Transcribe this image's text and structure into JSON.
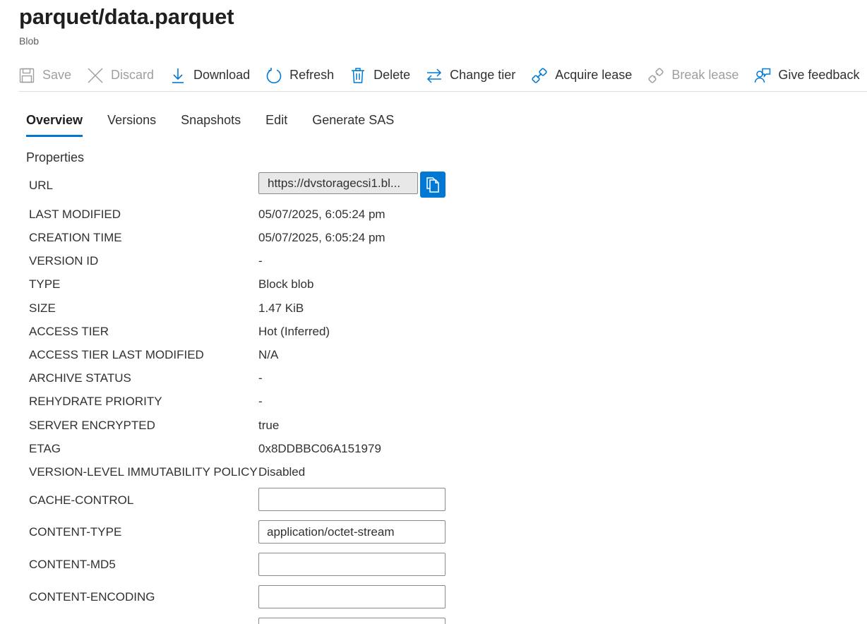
{
  "header": {
    "title": "parquet/data.parquet",
    "subtitle": "Blob"
  },
  "toolbar": {
    "save": "Save",
    "discard": "Discard",
    "download": "Download",
    "refresh": "Refresh",
    "delete": "Delete",
    "change_tier": "Change tier",
    "acquire_lease": "Acquire lease",
    "break_lease": "Break lease",
    "give_feedback": "Give feedback"
  },
  "tabs": [
    "Overview",
    "Versions",
    "Snapshots",
    "Edit",
    "Generate SAS"
  ],
  "active_tab": "Overview",
  "properties": {
    "section_title": "Properties",
    "url_label": "URL",
    "url_value": "https://dvstoragecsi1.bl...",
    "rows": [
      {
        "label": "LAST MODIFIED",
        "value": "05/07/2025, 6:05:24 pm"
      },
      {
        "label": "CREATION TIME",
        "value": "05/07/2025, 6:05:24 pm"
      },
      {
        "label": "VERSION ID",
        "value": "-"
      },
      {
        "label": "TYPE",
        "value": "Block blob"
      },
      {
        "label": "SIZE",
        "value": "1.47 KiB"
      },
      {
        "label": "ACCESS TIER",
        "value": "Hot (Inferred)"
      },
      {
        "label": "ACCESS TIER LAST MODIFIED",
        "value": "N/A"
      },
      {
        "label": "ARCHIVE STATUS",
        "value": "-"
      },
      {
        "label": "REHYDRATE PRIORITY",
        "value": "-"
      },
      {
        "label": "SERVER ENCRYPTED",
        "value": "true"
      },
      {
        "label": "ETAG",
        "value": "0x8DDBBC06A151979"
      },
      {
        "label": "VERSION-LEVEL IMMUTABILITY POLICY",
        "value": "Disabled"
      }
    ],
    "fields": [
      {
        "label": "CACHE-CONTROL",
        "value": ""
      },
      {
        "label": "CONTENT-TYPE",
        "value": "application/octet-stream"
      },
      {
        "label": "CONTENT-MD5",
        "value": ""
      },
      {
        "label": "CONTENT-ENCODING",
        "value": ""
      },
      {
        "label": "",
        "value": ""
      }
    ]
  },
  "colors": {
    "accent": "#0078d4",
    "disabled": "#a19f9d"
  }
}
